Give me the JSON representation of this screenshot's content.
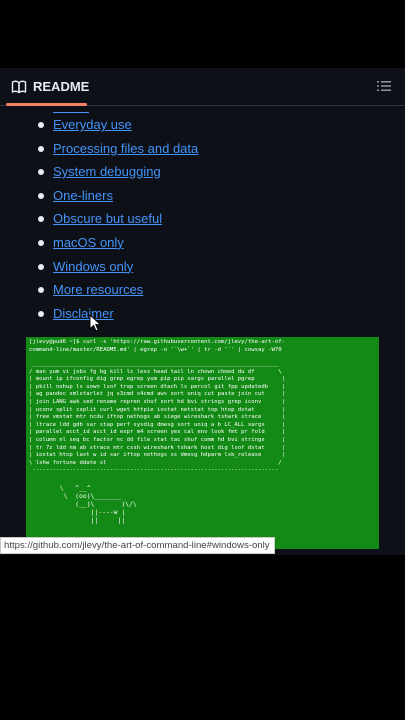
{
  "readme": {
    "title": "README",
    "toc": [
      "Everyday use",
      "Processing files and data",
      "System debugging",
      "One-liners",
      "Obscure but useful",
      "macOS only",
      "Windows only",
      "More resources",
      "Disclaimer"
    ]
  },
  "terminal": {
    "command": "[jlevy@pud6 ~]$ curl -s 'https://raw.githubusercontent.com/jlevy/the-art-of-\ncommand-line/master/README.md' | egrep -o '`\\w+`' | tr -d '`' | cowsay -W70",
    "bubble": " _________________________________________________________________________\n/ man yum vi jobs fg bg kill ls less head tail ln chown chmod du df       \\\n| mount ip ifconfig dig grep egrep yum pip pip xargs parallel pgrep        |\n| pkill nohup ls uown lsof trap screen dtach ls percol git fpp updatedb    |\n| ag pandoc xmlstarlet jq s3cmd s4cmd aws sort uniq cut paste join cut     |\n| join LANG awk sed rename repren shuf sort hd bvi strings grep iconv      |\n| uconv split csplit curl wget httpie iostat netstat top htop dstat        |\n| free vmstat mtr ncdu iftop nethogs ab siege wireshark tshark strace      |\n| ltrace ldd gdb sar stap perf sysdig dmesg sort uniq a b LC_ALL xargs     |\n| parallel acct_id acct_id expr m4 screen yes cal env look fmt pr fold     |\n| column nl seq bc factor nc dd file stat tac shuf comm hd bvi strings     |\n| tr 7z ldd nm ab strace mtr cssh wireshark tshark host dig lsof dstat     |\n| iostat htop last w id sar iftop nethogs ss dmesg hdparm lsb_release      |\n\\ lshw fortune ddate sl                                                   /\n -------------------------------------------------------------------------",
    "cow": "        \\   ^__^\n         \\  (oo)\\_______\n            (__)\\       )\\/\\\n                ||----w |\n                ||     ||"
  },
  "status_bar": {
    "url": "https://github.com/jlevy/the-art-of-command-line#windows-only"
  }
}
